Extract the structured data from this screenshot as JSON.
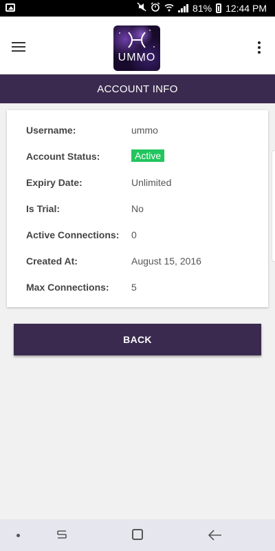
{
  "status_bar": {
    "battery_percent": "81%",
    "time": "12:44 PM",
    "icons": [
      "image-icon",
      "mute-icon",
      "alarm-icon",
      "wifi-icon",
      "signal-icon",
      "battery-icon"
    ]
  },
  "app_bar": {
    "logo_text": "UMMO",
    "menu_icon": "hamburger-menu-icon",
    "overflow_icon": "more-vert-icon"
  },
  "page": {
    "title": "ACCOUNT INFO"
  },
  "account": {
    "rows": [
      {
        "label": "Username:",
        "value": "ummo"
      },
      {
        "label": "Account Status:",
        "value": "Active",
        "badge_color": "#22c55e"
      },
      {
        "label": "Expiry Date:",
        "value": "Unlimited"
      },
      {
        "label": "Is Trial:",
        "value": "No"
      },
      {
        "label": "Active Connections:",
        "value": "0"
      },
      {
        "label": "Created At:",
        "value": "August 15, 2016"
      },
      {
        "label": "Max Connections:",
        "value": "5"
      }
    ]
  },
  "buttons": {
    "back_label": "BACK"
  },
  "colors": {
    "primary": "#3b2a4f",
    "status_active": "#22c55e"
  }
}
